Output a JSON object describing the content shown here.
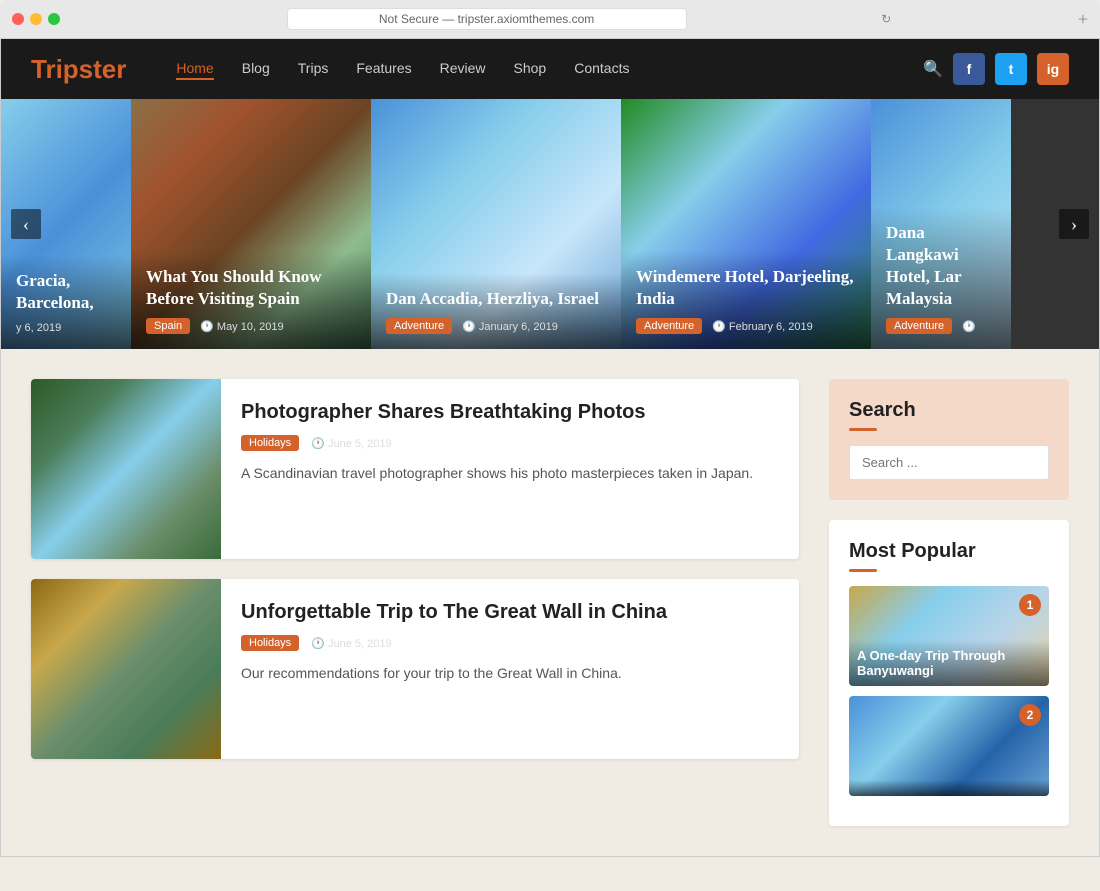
{
  "browser": {
    "traffic_lights": [
      "red",
      "yellow",
      "green"
    ],
    "address": "Not Secure — tripster.axiomthemes.com",
    "new_tab": "+"
  },
  "navbar": {
    "logo_text": "Trip",
    "logo_accent": "ster",
    "nav_items": [
      {
        "label": "Home",
        "active": true
      },
      {
        "label": "Blog",
        "active": false
      },
      {
        "label": "Trips",
        "active": false
      },
      {
        "label": "Features",
        "active": false
      },
      {
        "label": "Review",
        "active": false
      },
      {
        "label": "Shop",
        "active": false
      },
      {
        "label": "Contacts",
        "active": false
      }
    ],
    "social": [
      {
        "label": "f",
        "class": "fb"
      },
      {
        "label": "t",
        "class": "tw"
      },
      {
        "label": "ig",
        "class": "ig"
      }
    ]
  },
  "slider": {
    "left_arrow": "‹",
    "right_arrow": "›",
    "slides": [
      {
        "id": "s1",
        "title": "Gracia, Barcelona,",
        "badge": "",
        "date": "y 6, 2019",
        "badge_label": ""
      },
      {
        "id": "s2",
        "title": "What You Should Know Before Visiting Spain",
        "badge_label": "Spain",
        "date": "May 10, 2019"
      },
      {
        "id": "s3",
        "title": "Dan Accadia, Herzliya, Israel",
        "badge_label": "Adventure",
        "date": "January 6, 2019"
      },
      {
        "id": "s4",
        "title": "Windemere Hotel, Darjeeling, India",
        "badge_label": "Adventure",
        "date": "February 6, 2019"
      },
      {
        "id": "s5",
        "title": "Dana Langkawi Hotel, Lar Malaysia",
        "badge_label": "Adventure",
        "date": ""
      }
    ]
  },
  "articles": [
    {
      "id": "a1",
      "title": "Photographer Shares Breathtaking Photos",
      "badge": "Holidays",
      "date": "June 5, 2019",
      "excerpt": "A Scandinavian travel photographer shows his photo masterpieces taken in Japan."
    },
    {
      "id": "a2",
      "title": "Unforgettable Trip to The Great Wall in China",
      "badge": "Holidays",
      "date": "June 5, 2019",
      "excerpt": "Our recommendations for your trip to the Great Wall in China."
    }
  ],
  "sidebar": {
    "search": {
      "title": "Search",
      "placeholder": "Search ...",
      "button_icon": "🔍"
    },
    "most_popular": {
      "title": "Most Popular",
      "items": [
        {
          "number": "1",
          "caption": "A One-day Trip Through Banyuwangi"
        },
        {
          "number": "2",
          "caption": ""
        }
      ]
    }
  }
}
